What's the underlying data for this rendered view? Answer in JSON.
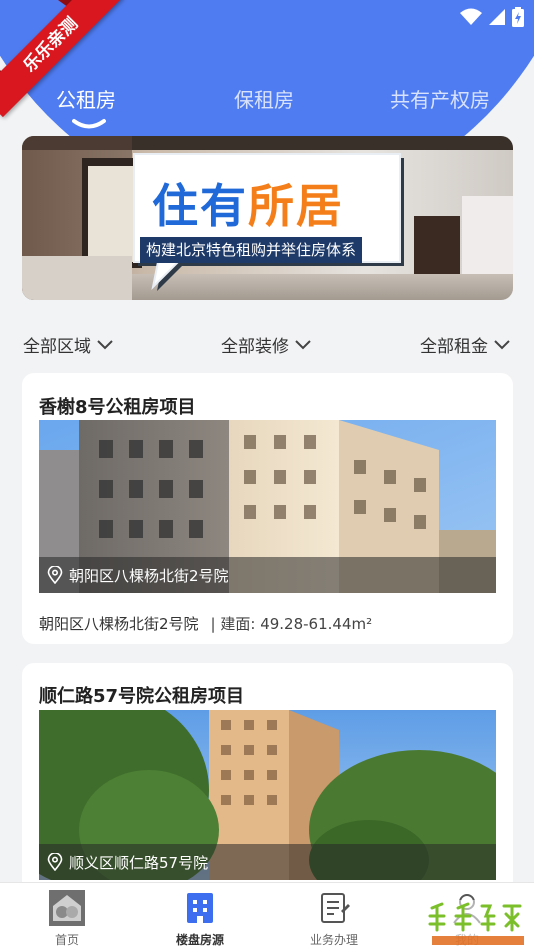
{
  "status_bar": {
    "icons": [
      "wifi-icon",
      "signal-icon",
      "battery-icon"
    ]
  },
  "watermark_ribbon": {
    "text": "乐乐亲测"
  },
  "tabs": [
    {
      "label": "公租房",
      "active": true
    },
    {
      "label": "保租房",
      "active": false
    },
    {
      "label": "共有产权房",
      "active": false
    }
  ],
  "banner": {
    "headline_part1": "住有",
    "headline_part2": "所居",
    "subtitle": "构建北京特色租购并举住房体系"
  },
  "filters": [
    {
      "label": "全部区域"
    },
    {
      "label": "全部装修"
    },
    {
      "label": "全部租金"
    }
  ],
  "projects": [
    {
      "title": "香榭8号公租房项目",
      "location": "朝阳区八棵杨北街2号院",
      "address": "朝阳区八棵杨北街2号院",
      "area": "| 建面: 49.28-61.44m²"
    },
    {
      "title": "顺仁路57号院公租房项目",
      "location": "顺义区顺仁路57号院"
    }
  ],
  "bottom_nav": [
    {
      "label": "首页",
      "active": false
    },
    {
      "label": "楼盘房源",
      "active": true
    },
    {
      "label": "业务办理",
      "active": false
    },
    {
      "label": "我的",
      "active": false
    }
  ],
  "colors": {
    "primary": "#4f7cf1",
    "nav_active": "#3d6ef0",
    "ribbon": "#d8171f",
    "banner_orange": "#f47f1a",
    "banner_blue": "#1f69d8"
  }
}
